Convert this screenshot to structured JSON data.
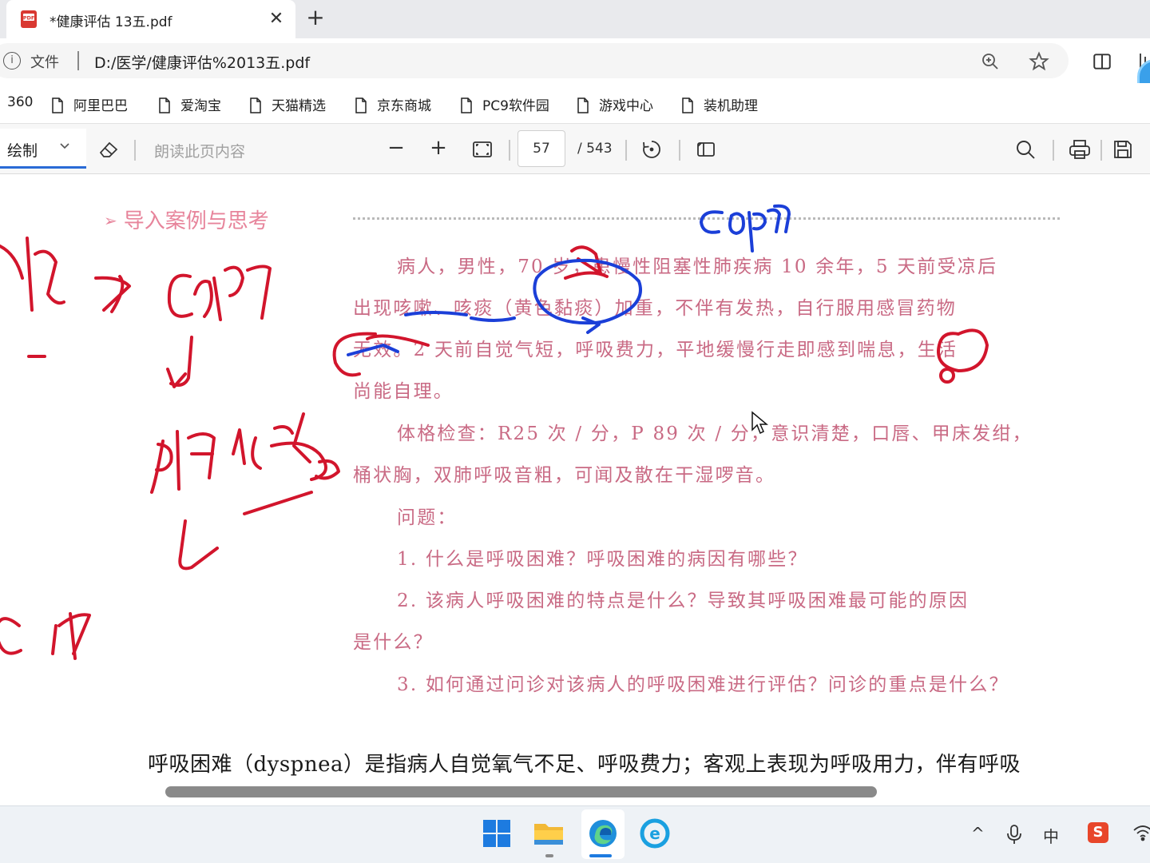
{
  "tab": {
    "title": "*健康评估 13五.pdf",
    "close": "✕",
    "new_tab": "+"
  },
  "address": {
    "info_icon": "i",
    "file_label": "文件",
    "url": "D:/医学/健康评估%2013五.pdf"
  },
  "bookmarks": [
    {
      "label": "360"
    },
    {
      "label": "阿里巴巴"
    },
    {
      "label": "爱淘宝"
    },
    {
      "label": "天猫精选"
    },
    {
      "label": "京东商城"
    },
    {
      "label": "PC9软件园"
    },
    {
      "label": "游戏中心"
    },
    {
      "label": "装机助理"
    }
  ],
  "pdf_toolbar": {
    "draw_label": "绘制",
    "read_aloud": "朗读此页内容",
    "zoom_out": "−",
    "zoom_in": "+",
    "page_current": "57",
    "page_total": "/ 543"
  },
  "document": {
    "section_heading": "导入案例与思考",
    "case_lines": [
      "病人，男性，70 岁，患慢性阻塞性肺疾病 10 余年，5 天前受凉后",
      "出现咳嗽、咳痰（黄色黏痰）加重，不伴有发热，自行服用感冒药物",
      "无效。2 天前自觉气短，呼吸费力，平地缓慢行走即感到喘息，生活",
      "尚能自理。"
    ],
    "exam_lines": [
      "体格检查：R25 次 / 分，P 89 次 / 分，意识清楚，口唇、甲床发绀，",
      "桶状胸，双肺呼吸音粗，可闻及散在干湿啰音。"
    ],
    "questions_label": "问题：",
    "questions": [
      "1.  什么是呼吸困难？呼吸困难的病因有哪些？",
      "2.  该病人呼吸困难的特点是什么？导致其呼吸困难最可能的原因",
      "是什么？",
      "3.  如何通过问诊对该病人的呼吸困难进行评估？问诊的重点是什么？"
    ],
    "body_line": "呼吸困难（dyspnea）是指病人自觉氧气不足、呼吸费力；客观上表现为呼吸用力，伴有呼吸"
  },
  "taskbar": {
    "apps": [
      "windows-start",
      "file-explorer",
      "edge-browser",
      "ie-browser"
    ],
    "tray": {
      "chevron": "^",
      "ime": "中",
      "sogou": "S"
    }
  },
  "colors": {
    "pink_text": "#c96a84",
    "red_ink": "#d2152c",
    "blue_ink": "#1b3fd8",
    "accent": "#2a6bd6"
  }
}
